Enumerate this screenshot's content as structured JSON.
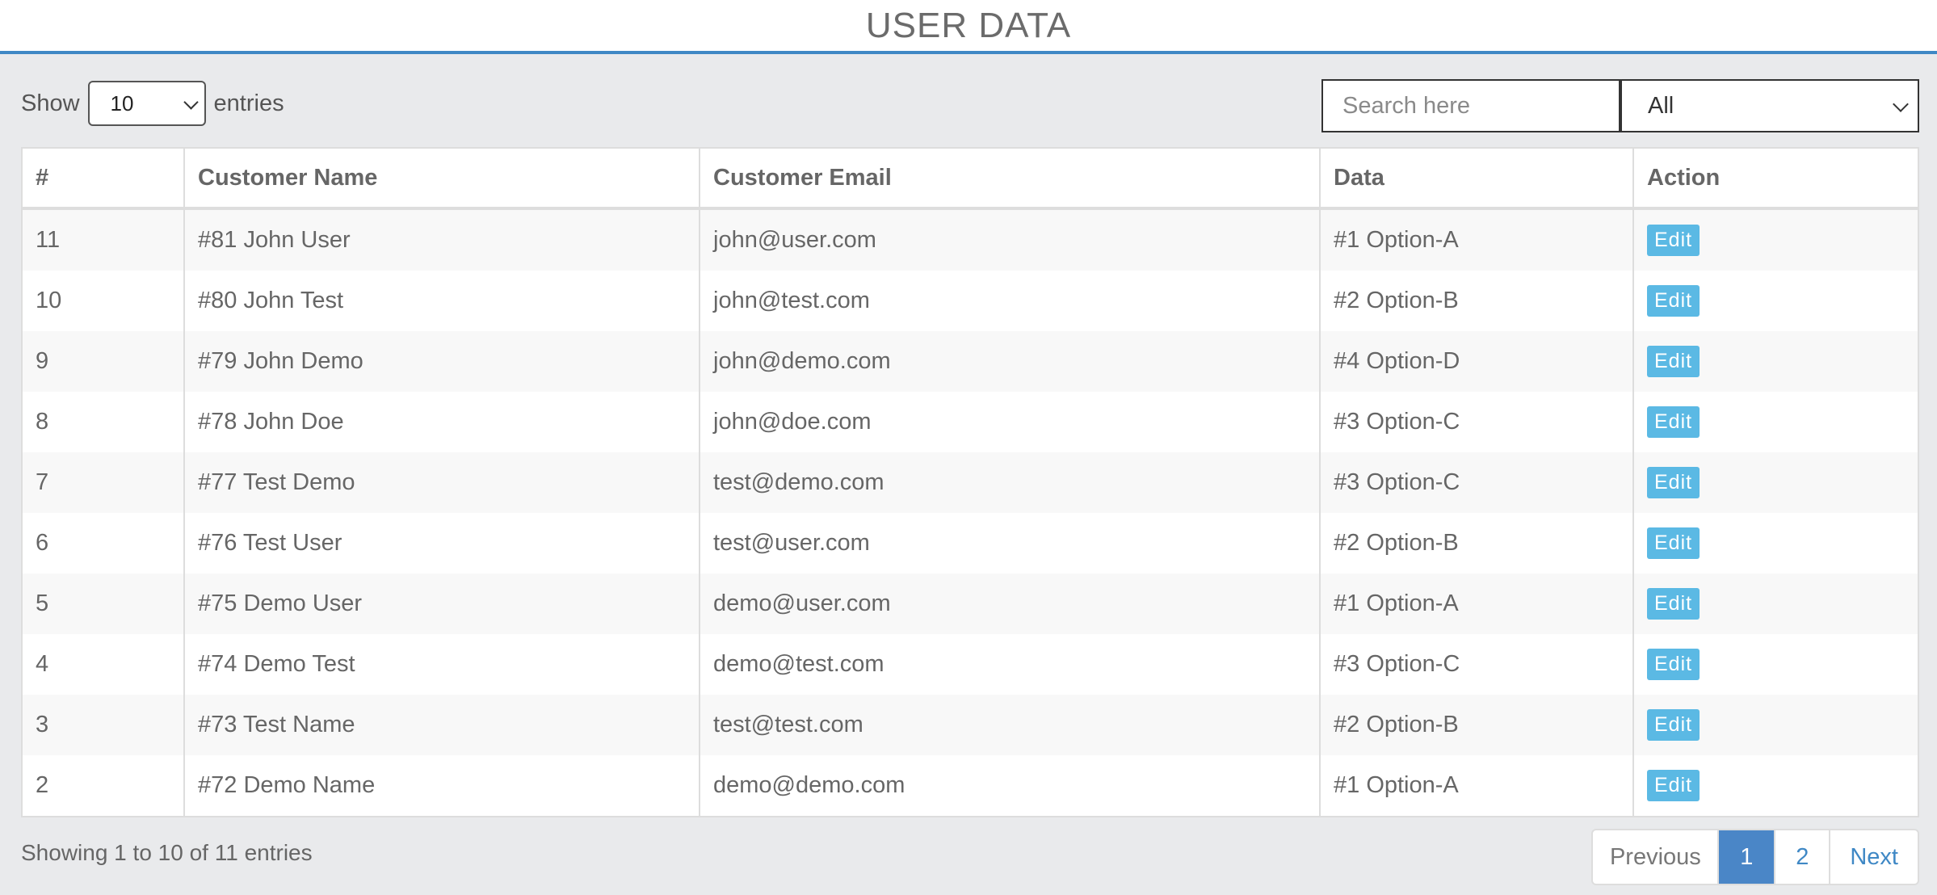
{
  "header": {
    "title": "USER DATA"
  },
  "length_control": {
    "prefix": "Show",
    "value": "10",
    "suffix": "entries"
  },
  "search": {
    "placeholder": "Search here"
  },
  "filter": {
    "value": "All"
  },
  "table": {
    "columns": [
      "#",
      "Customer Name",
      "Customer Email",
      "Data",
      "Action"
    ],
    "rows": [
      {
        "id": "11",
        "name": "#81 John User",
        "email": "john@user.com",
        "data": "#1 Option-A",
        "action": "Edit"
      },
      {
        "id": "10",
        "name": "#80 John Test",
        "email": "john@test.com",
        "data": "#2 Option-B",
        "action": "Edit"
      },
      {
        "id": "9",
        "name": "#79 John Demo",
        "email": "john@demo.com",
        "data": "#4 Option-D",
        "action": "Edit"
      },
      {
        "id": "8",
        "name": "#78 John Doe",
        "email": "john@doe.com",
        "data": "#3 Option-C",
        "action": "Edit"
      },
      {
        "id": "7",
        "name": "#77 Test Demo",
        "email": "test@demo.com",
        "data": "#3 Option-C",
        "action": "Edit"
      },
      {
        "id": "6",
        "name": "#76 Test User",
        "email": "test@user.com",
        "data": "#2 Option-B",
        "action": "Edit"
      },
      {
        "id": "5",
        "name": "#75 Demo User",
        "email": "demo@user.com",
        "data": "#1 Option-A",
        "action": "Edit"
      },
      {
        "id": "4",
        "name": "#74 Demo Test",
        "email": "demo@test.com",
        "data": "#3 Option-C",
        "action": "Edit"
      },
      {
        "id": "3",
        "name": "#73 Test Name",
        "email": "test@test.com",
        "data": "#2 Option-B",
        "action": "Edit"
      },
      {
        "id": "2",
        "name": "#72 Demo Name",
        "email": "demo@demo.com",
        "data": "#1 Option-A",
        "action": "Edit"
      }
    ]
  },
  "footer": {
    "info": "Showing 1 to 10 of 11 entries"
  },
  "pagination": {
    "previous": "Previous",
    "pages": [
      "1",
      "2"
    ],
    "next": "Next",
    "active_page": "1"
  },
  "colors": {
    "accent": "#3f88c5",
    "edit_button": "#5bb9e4",
    "active_page": "#4a86c7"
  }
}
